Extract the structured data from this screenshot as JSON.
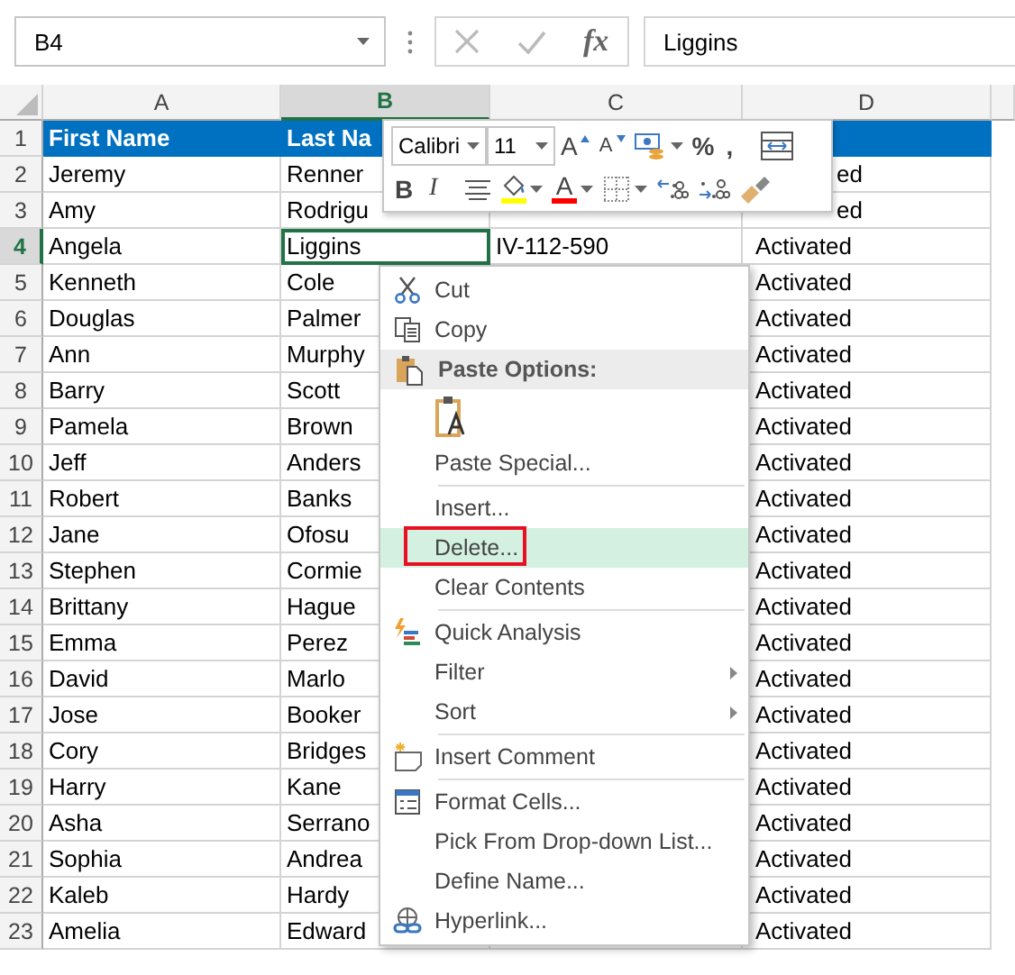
{
  "formula_bar": {
    "name_box": "B4",
    "function_button": "fx",
    "value": "Liggins"
  },
  "columns": [
    {
      "label": "A",
      "selected": false
    },
    {
      "label": "B",
      "selected": true
    },
    {
      "label": "C",
      "selected": false
    },
    {
      "label": "D",
      "selected": false
    }
  ],
  "rows": [
    {
      "number": "1",
      "selected": false,
      "A": "First Name",
      "B": "Last Na"
    },
    {
      "number": "2",
      "selected": false,
      "A": "Jeremy",
      "B": "Renner",
      "D": "ed"
    },
    {
      "number": "3",
      "selected": false,
      "A": "Amy",
      "B": "Rodrigu",
      "D": "ed"
    },
    {
      "number": "4",
      "selected": true,
      "A": "Angela",
      "B": "Liggins",
      "C": "IV-112-590",
      "D": "Activated"
    },
    {
      "number": "5",
      "selected": false,
      "A": "Kenneth",
      "B": "Cole",
      "D": "Activated"
    },
    {
      "number": "6",
      "selected": false,
      "A": "Douglas",
      "B": "Palmer",
      "D": "Activated"
    },
    {
      "number": "7",
      "selected": false,
      "A": "Ann",
      "B": "Murphy",
      "D": "Activated"
    },
    {
      "number": "8",
      "selected": false,
      "A": "Barry",
      "B": "Scott",
      "D": "Activated"
    },
    {
      "number": "9",
      "selected": false,
      "A": "Pamela",
      "B": "Brown",
      "D": "Activated"
    },
    {
      "number": "10",
      "selected": false,
      "A": "Jeff",
      "B": "Anders",
      "D": "Activated"
    },
    {
      "number": "11",
      "selected": false,
      "A": "Robert",
      "B": "Banks",
      "D": "Activated"
    },
    {
      "number": "12",
      "selected": false,
      "A": "Jane",
      "B": "Ofosu",
      "D": "Activated"
    },
    {
      "number": "13",
      "selected": false,
      "A": "Stephen",
      "B": "Cormie",
      "D": "Activated"
    },
    {
      "number": "14",
      "selected": false,
      "A": "Brittany",
      "B": "Hague",
      "D": "Activated"
    },
    {
      "number": "15",
      "selected": false,
      "A": "Emma",
      "B": "Perez",
      "D": "Activated"
    },
    {
      "number": "16",
      "selected": false,
      "A": "David",
      "B": "Marlo",
      "D": "Activated"
    },
    {
      "number": "17",
      "selected": false,
      "A": "Jose",
      "B": "Booker",
      "D": "Activated"
    },
    {
      "number": "18",
      "selected": false,
      "A": "Cory",
      "B": "Bridges",
      "D": "Activated"
    },
    {
      "number": "19",
      "selected": false,
      "A": "Harry",
      "B": "Kane",
      "D": "Activated"
    },
    {
      "number": "20",
      "selected": false,
      "A": "Asha",
      "B": "Serrano",
      "D": "Activated"
    },
    {
      "number": "21",
      "selected": false,
      "A": "Sophia",
      "B": "Andrea",
      "D": "Activated"
    },
    {
      "number": "22",
      "selected": false,
      "A": "Kaleb",
      "B": "Hardy",
      "D": "Activated"
    },
    {
      "number": "23",
      "selected": false,
      "A": "Amelia",
      "B": "Edward",
      "D": "Activated"
    }
  ],
  "mini_toolbar": {
    "top_row": [
      {
        "kind": "combo",
        "value": "Calibri"
      },
      {
        "kind": "combo",
        "value": "11"
      },
      {
        "kind": "grow",
        "glyph": "A"
      },
      {
        "kind": "shrink",
        "glyph": "A"
      },
      {
        "kind": "accounting",
        "dropdown": true
      },
      {
        "kind": "glyph",
        "glyph": "%"
      },
      {
        "kind": "glyph",
        "glyph": ","
      },
      {
        "kind": "wrap"
      }
    ],
    "bottom_row": [
      {
        "kind": "bold",
        "glyph": "B"
      },
      {
        "kind": "italic",
        "glyph": "I"
      },
      {
        "kind": "align"
      },
      {
        "kind": "fill",
        "color": "#ffff00",
        "dropdown": true
      },
      {
        "kind": "fontcolor",
        "glyph": "A",
        "color": "#ff0000",
        "dropdown": true
      },
      {
        "kind": "borders",
        "dropdown": true
      },
      {
        "kind": "incdec"
      },
      {
        "kind": "decdec"
      },
      {
        "kind": "painter"
      }
    ]
  },
  "context_menu": {
    "items": [
      {
        "kind": "item",
        "label": "Cut",
        "selected": false,
        "outlined": false,
        "submenu": false
      },
      {
        "kind": "item",
        "label": "Copy",
        "selected": false,
        "outlined": false,
        "submenu": false
      },
      {
        "kind": "header",
        "label": "Paste Options:"
      },
      {
        "kind": "paste_option"
      },
      {
        "kind": "item",
        "label": "Paste Special...",
        "selected": false,
        "outlined": false,
        "submenu": false
      },
      {
        "kind": "separator"
      },
      {
        "kind": "item",
        "label": "Insert...",
        "selected": false,
        "outlined": false,
        "submenu": false
      },
      {
        "kind": "item",
        "label": "Delete...",
        "selected": true,
        "outlined": true,
        "submenu": false
      },
      {
        "kind": "item",
        "label": "Clear Contents",
        "selected": false,
        "outlined": false,
        "submenu": false
      },
      {
        "kind": "separator"
      },
      {
        "kind": "item",
        "label": "Quick Analysis",
        "selected": false,
        "outlined": false,
        "submenu": false
      },
      {
        "kind": "item",
        "label": "Filter",
        "selected": false,
        "outlined": false,
        "submenu": true
      },
      {
        "kind": "item",
        "label": "Sort",
        "selected": false,
        "outlined": false,
        "submenu": true
      },
      {
        "kind": "separator"
      },
      {
        "kind": "item",
        "label": "Insert Comment",
        "selected": false,
        "outlined": false,
        "submenu": false
      },
      {
        "kind": "separator"
      },
      {
        "kind": "item",
        "label": "Format Cells...",
        "selected": false,
        "outlined": false,
        "submenu": false
      },
      {
        "kind": "item",
        "label": "Pick From Drop-down List...",
        "selected": false,
        "outlined": false,
        "submenu": false
      },
      {
        "kind": "item",
        "label": "Define Name...",
        "selected": false,
        "outlined": false,
        "submenu": false
      },
      {
        "kind": "item",
        "label": "Hyperlink...",
        "selected": false,
        "outlined": false,
        "submenu": false
      }
    ]
  }
}
